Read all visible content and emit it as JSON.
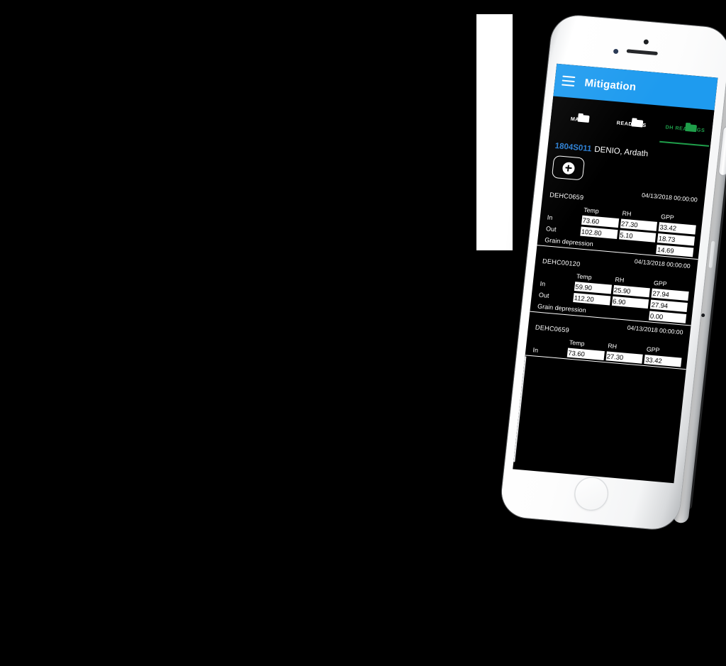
{
  "app": {
    "title": "Mitigation",
    "menu_icon": "hamburger-menu-icon"
  },
  "tabs": [
    {
      "label": "MAIN",
      "icon": "folder-icon",
      "active": false
    },
    {
      "label": "READINGS",
      "icon": "folder-icon",
      "active": false
    },
    {
      "label": "DH READINGS",
      "icon": "folder-icon",
      "active": true
    }
  ],
  "client": {
    "id": "1804S011",
    "name": "DENIO, Ardath"
  },
  "actions": {
    "add_label": "+",
    "add_icon": "plus-circle-icon"
  },
  "table": {
    "columns": [
      "Temp",
      "RH",
      "GPP"
    ],
    "row_labels": {
      "in": "In",
      "out": "Out",
      "grain_depression": "Grain depression"
    }
  },
  "readings": [
    {
      "equipment_id": "DEHC0659",
      "datetime": "04/13/2018 00:00:00",
      "in": {
        "temp": "73.60",
        "rh": "27.30",
        "gpp": "33.42"
      },
      "out": {
        "temp": "102.80",
        "rh": "5.10",
        "gpp": "18.73"
      },
      "grain_depression": "14.69"
    },
    {
      "equipment_id": "DEHC00120",
      "datetime": "04/13/2018 00:00:00",
      "in": {
        "temp": "59.90",
        "rh": "25.90",
        "gpp": "27.94"
      },
      "out": {
        "temp": "112.20",
        "rh": "6.90",
        "gpp": "27.94"
      },
      "grain_depression": "0.00"
    },
    {
      "equipment_id": "DEHC0659",
      "datetime": "04/13/2018 00:00:00",
      "in": {
        "temp": "73.60",
        "rh": "27.30",
        "gpp": "33.42"
      },
      "out": {
        "temp": "",
        "rh": "",
        "gpp": ""
      },
      "grain_depression": ""
    }
  ],
  "colors": {
    "appbar_blue": "#1E9BEF",
    "active_tab_green": "#1F9E4A",
    "client_id_blue": "#2B7FD4",
    "screen_background": "#000000",
    "cell_background": "#ffffff"
  }
}
